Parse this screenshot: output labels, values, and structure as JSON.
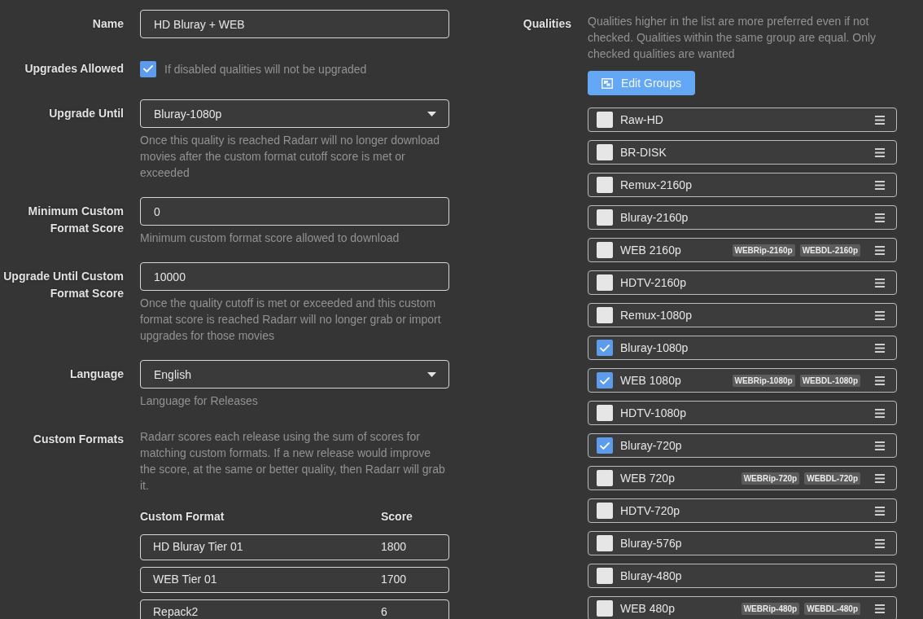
{
  "left_fields": [
    {
      "kind": "text",
      "label": "Name",
      "value": "HD Bluray + WEB"
    },
    {
      "kind": "checkbox",
      "label": "Upgrades Allowed",
      "checked": true,
      "help": "If disabled qualities will not be upgraded"
    },
    {
      "kind": "select",
      "label": "Upgrade Until",
      "value": "Bluray-1080p",
      "help": "Once this quality is reached Radarr will no longer download movies after the custom format cutoff score is met or exceeded"
    },
    {
      "kind": "text",
      "label": "Minimum Custom Format Score",
      "value": "0",
      "help": "Minimum custom format score allowed to download"
    },
    {
      "kind": "text",
      "label": "Upgrade Until Custom Format Score",
      "value": "10000",
      "help": "Once the quality cutoff is met or exceeded and this custom format score is reached Radarr will no longer grab or import upgrades for those movies"
    },
    {
      "kind": "select",
      "label": "Language",
      "value": "English",
      "help": "Language for Releases"
    },
    {
      "kind": "custom_formats",
      "label": "Custom Formats",
      "help": "Radarr scores each release using the sum of scores for matching custom formats. If a new release would improve the score, at the same or better quality, then Radarr will grab it.",
      "columns": [
        "Custom Format",
        "Score"
      ],
      "rows": [
        {
          "name": "HD Bluray Tier 01",
          "score": "1800"
        },
        {
          "name": "WEB Tier 01",
          "score": "1700"
        },
        {
          "name": "Repack2",
          "score": "6"
        }
      ]
    }
  ],
  "qualities": {
    "label": "Qualities",
    "help": "Qualities higher in the list are more preferred even if not checked. Qualities within the same group are equal. Only checked qualities are wanted",
    "edit_groups_button": "Edit Groups",
    "items": [
      {
        "name": "Raw-HD",
        "checked": false
      },
      {
        "name": "BR-DISK",
        "checked": false
      },
      {
        "name": "Remux-2160p",
        "checked": false
      },
      {
        "name": "Bluray-2160p",
        "checked": false
      },
      {
        "name": "WEB 2160p",
        "checked": false,
        "tags": [
          "WEBRip-2160p",
          "WEBDL-2160p"
        ]
      },
      {
        "name": "HDTV-2160p",
        "checked": false
      },
      {
        "name": "Remux-1080p",
        "checked": false
      },
      {
        "name": "Bluray-1080p",
        "checked": true
      },
      {
        "name": "WEB 1080p",
        "checked": true,
        "tags": [
          "WEBRip-1080p",
          "WEBDL-1080p"
        ]
      },
      {
        "name": "HDTV-1080p",
        "checked": false
      },
      {
        "name": "Bluray-720p",
        "checked": true
      },
      {
        "name": "WEB 720p",
        "checked": false,
        "tags": [
          "WEBRip-720p",
          "WEBDL-720p"
        ]
      },
      {
        "name": "HDTV-720p",
        "checked": false
      },
      {
        "name": "Bluray-576p",
        "checked": false
      },
      {
        "name": "Bluray-480p",
        "checked": false
      },
      {
        "name": "WEB 480p",
        "checked": false,
        "tags": [
          "WEBRip-480p",
          "WEBDL-480p"
        ]
      }
    ]
  }
}
